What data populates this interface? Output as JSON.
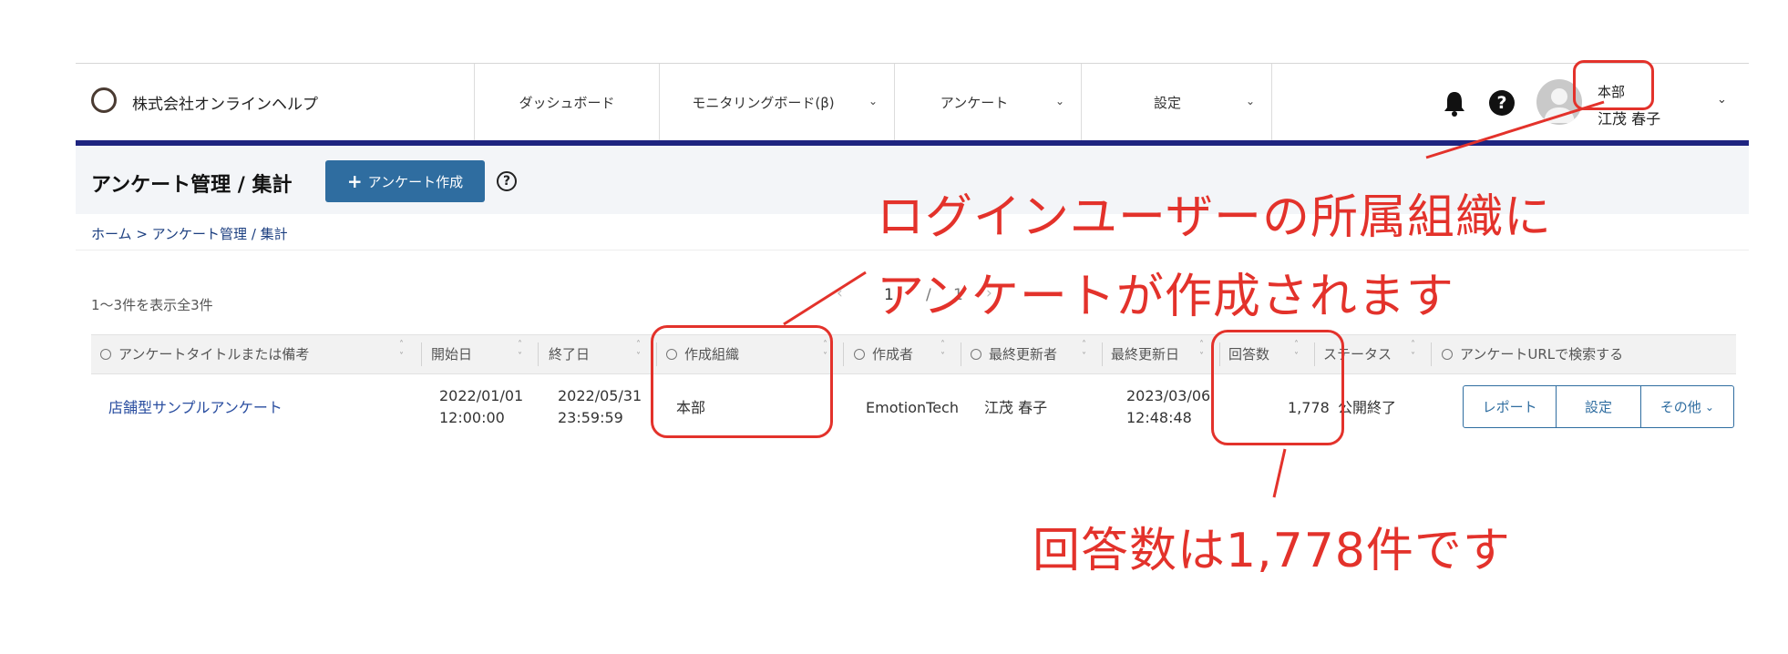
{
  "header": {
    "company": "株式会社オンラインヘルプ",
    "nav": [
      {
        "label": "ダッシュボード"
      },
      {
        "label": "モニタリングボード(β)"
      },
      {
        "label": "アンケート"
      },
      {
        "label": "設定"
      }
    ],
    "user": {
      "org": "本部",
      "name": "江茂 春子"
    }
  },
  "page": {
    "title": "アンケート管理 / 集計",
    "create_button": "アンケート作成",
    "create_plus": "+",
    "help": "?",
    "breadcrumb": "ホーム > アンケート管理 / 集計",
    "result_count": "1〜3件を表示全3件",
    "pager": {
      "current": "1",
      "separator": "/",
      "total": "1"
    }
  },
  "table": {
    "headers": {
      "title_search": "アンケートタイトルまたは備考",
      "start": "開始日",
      "end": "終了日",
      "org": "作成組織",
      "creator": "作成者",
      "updater": "最終更新者",
      "updated": "最終更新日",
      "responses": "回答数",
      "status": "ステータス",
      "url_search": "アンケートURLで検索する"
    },
    "rows": [
      {
        "title": "店舗型サンプルアンケート",
        "start_date": "2022/01/01",
        "start_time": "12:00:00",
        "end_date": "2022/05/31",
        "end_time": "23:59:59",
        "org": "本部",
        "creator": "EmotionTech",
        "updater": "江茂 春子",
        "updated_date": "2023/03/06",
        "updated_time": "12:48:48",
        "responses": "1,778",
        "status": "公開終了",
        "actions": {
          "report": "レポート",
          "settings": "設定",
          "more": "その他"
        }
      }
    ]
  },
  "annotations": {
    "org_line1": "ログインユーザーの所属組織に",
    "org_line2": "アンケートが作成されます",
    "responses_note": "回答数は1,778件です",
    "color": "#e3322b"
  },
  "colors": {
    "brand_bar": "#1e2480",
    "primary": "#2f6da0",
    "link": "#2a4ea0"
  }
}
